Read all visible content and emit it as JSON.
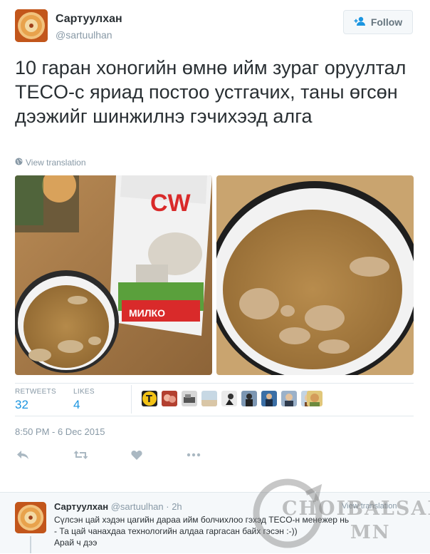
{
  "author": {
    "name": "Сартуулхан",
    "handle": "@sartuulhan"
  },
  "follow_button": {
    "label": "Follow"
  },
  "tweet": {
    "text": "10 гаран хоногийн өмнө ийм зураг оруултал TECO-с яриад постоо устгачих, таны өгсөн дээжийг шинжилнэ гэчихээд алга",
    "view_translation": "View translation",
    "product_label": "СW",
    "product_brand": "МИЛКО"
  },
  "stats": {
    "retweets_label": "RETWEETS",
    "retweets_value": "32",
    "likes_label": "LIKES",
    "likes_value": "4"
  },
  "timestamp": "8:50 PM - 6 Dec 2015",
  "actions": [
    "reply-icon",
    "retweet-icon",
    "like-icon",
    "more-icon"
  ],
  "reply": {
    "name": "Сартуулхан",
    "handle": "@sartuulhan",
    "time": "· 2h",
    "view_translation": "View translation",
    "line1": "Сүлсэн цай хэдэн цагийн дараа ийм болчихлоо гэхэд TECO-н менежер нь",
    "line2": "- Та цай чанахдаа технологийн алдаа гаргасан байх гэсэн :-))",
    "line3": "Арай ч дээ"
  },
  "watermark": {
    "main": "CHOIBALSAN",
    "sub": "MN"
  },
  "colors": {
    "link": "#1b95e0",
    "muted": "#8899a6",
    "text": "#292f33",
    "like": "#e81c4f"
  }
}
